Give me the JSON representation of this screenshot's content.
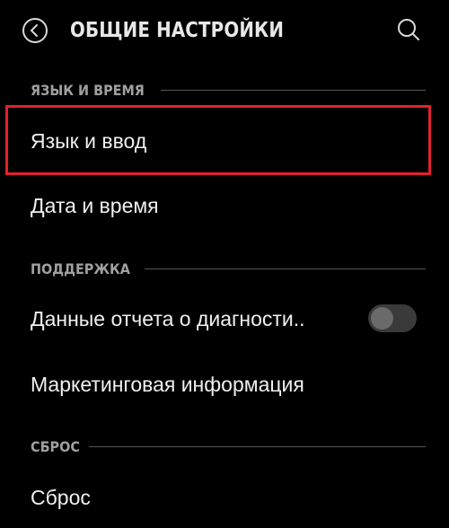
{
  "header": {
    "title": "ОБЩИЕ НАСТРОЙКИ",
    "back_icon": "back-arrow-icon",
    "search_icon": "search-icon"
  },
  "sections": [
    {
      "title": "ЯЗЫК И ВРЕМЯ",
      "items": [
        {
          "label": "Язык и ввод"
        },
        {
          "label": "Дата и время"
        }
      ]
    },
    {
      "title": "ПОДДЕРЖКА",
      "items": [
        {
          "label": "Данные отчета о диагности..",
          "toggle": false
        },
        {
          "label": "Маркетинговая информация"
        }
      ]
    },
    {
      "title": "СБРОС",
      "items": [
        {
          "label": "Сброс"
        }
      ]
    }
  ],
  "colors": {
    "background": "#000000",
    "highlight": "#e4202b",
    "section_text": "#a0a0a0",
    "item_text": "#f0f0f0"
  }
}
